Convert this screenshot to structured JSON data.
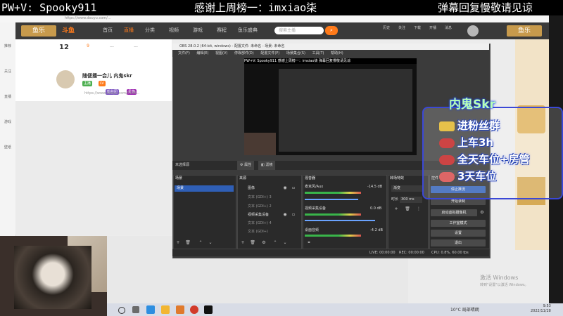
{
  "banner": {
    "left": "PW+V: Spooky911",
    "center": "感谢上周榜一：imxiao柒",
    "right": "弹幕回复慢敬请见谅"
  },
  "browser": {
    "url": "https://www.douyu.com/...",
    "brand": "斗鱼",
    "nav": [
      "首页",
      "直播",
      "分类",
      "视频",
      "游戏",
      "赛程",
      "鱼乐盛典"
    ],
    "search_placeholder": "搜索主播",
    "header_icons": [
      "历史",
      "关注",
      "下载",
      "开播",
      "消息"
    ],
    "left_rail": [
      "推荐",
      "关注",
      "直播",
      "游戏",
      "壁纸"
    ],
    "info_stats": [
      "12",
      "9",
      "...",
      "..."
    ],
    "host_name": "随便播一会儿 内鬼skr",
    "host_tags": [
      "主播",
      "LV",
      "粉丝团",
      "贵族"
    ],
    "room_url": "https://www.douyu.com/5198..."
  },
  "obs": {
    "title": "OBS 28.0.2 (64-bit, windows) - 配置文件: 未命名 - 场景: 未命名",
    "menu": [
      "文件(F)",
      "编辑(E)",
      "视图(V)",
      "停靠部件(D)",
      "配置文件(P)",
      "场景集合(S)",
      "工具(T)",
      "帮助(H)"
    ],
    "preview_banner": "PW+V: Spooky911    感谢上周榜一：imxiao柒    弹幕回复慢敬请见谅",
    "source_bar": {
      "label": "未选择源",
      "properties": "属性",
      "filters": "滤镜"
    },
    "panels": {
      "scenes": {
        "title": "场景",
        "items": [
          "场景"
        ]
      },
      "sources": {
        "title": "来源",
        "items": [
          "图像",
          "文本 (GDI+) 3",
          "文本 (GDI+) 2",
          "视频采集设备",
          "文本 (GDI+) 4",
          "文本 (GDI+)"
        ]
      },
      "mixer": {
        "title": "混音器",
        "channels": [
          {
            "name": "麦克风/Aux",
            "db": "-14.5 dB"
          },
          {
            "name": "视频采集设备",
            "db": "0.0 dB"
          },
          {
            "name": "桌面音频",
            "db": "-4.2 dB"
          }
        ]
      },
      "transitions": {
        "title": "转场特效",
        "type": "渐变",
        "duration_label": "时长",
        "duration": "300 ms"
      },
      "controls": {
        "title": "控件",
        "buttons": [
          "停止推流",
          "开始录制",
          "启动虚拟摄像机",
          "工作室模式",
          "设置",
          "退出"
        ]
      }
    },
    "status": {
      "live": "LIVE: 00:00:00",
      "rec": "REC: 00:00:00",
      "cpu": "CPU: 0.8%, 60.00 fps"
    }
  },
  "fans_overlay": {
    "title": "内鬼Skr",
    "lines": [
      "进粉丝群",
      "上车3h",
      "全天车位+房管",
      "3天车位"
    ]
  },
  "windows_watermark": {
    "line1": "激活 Windows",
    "line2": "转到\"设置\"以激活 Windows。"
  },
  "taskbar": {
    "weather": "10°C 局部晴朗",
    "time": "9:53",
    "date": "2022/11/28"
  },
  "colors": {
    "accent": "#ff7a1a",
    "obs_selected": "#2f5fb6",
    "overlay_border": "#3b48d6",
    "overlay_title": "#b9ffb6"
  }
}
